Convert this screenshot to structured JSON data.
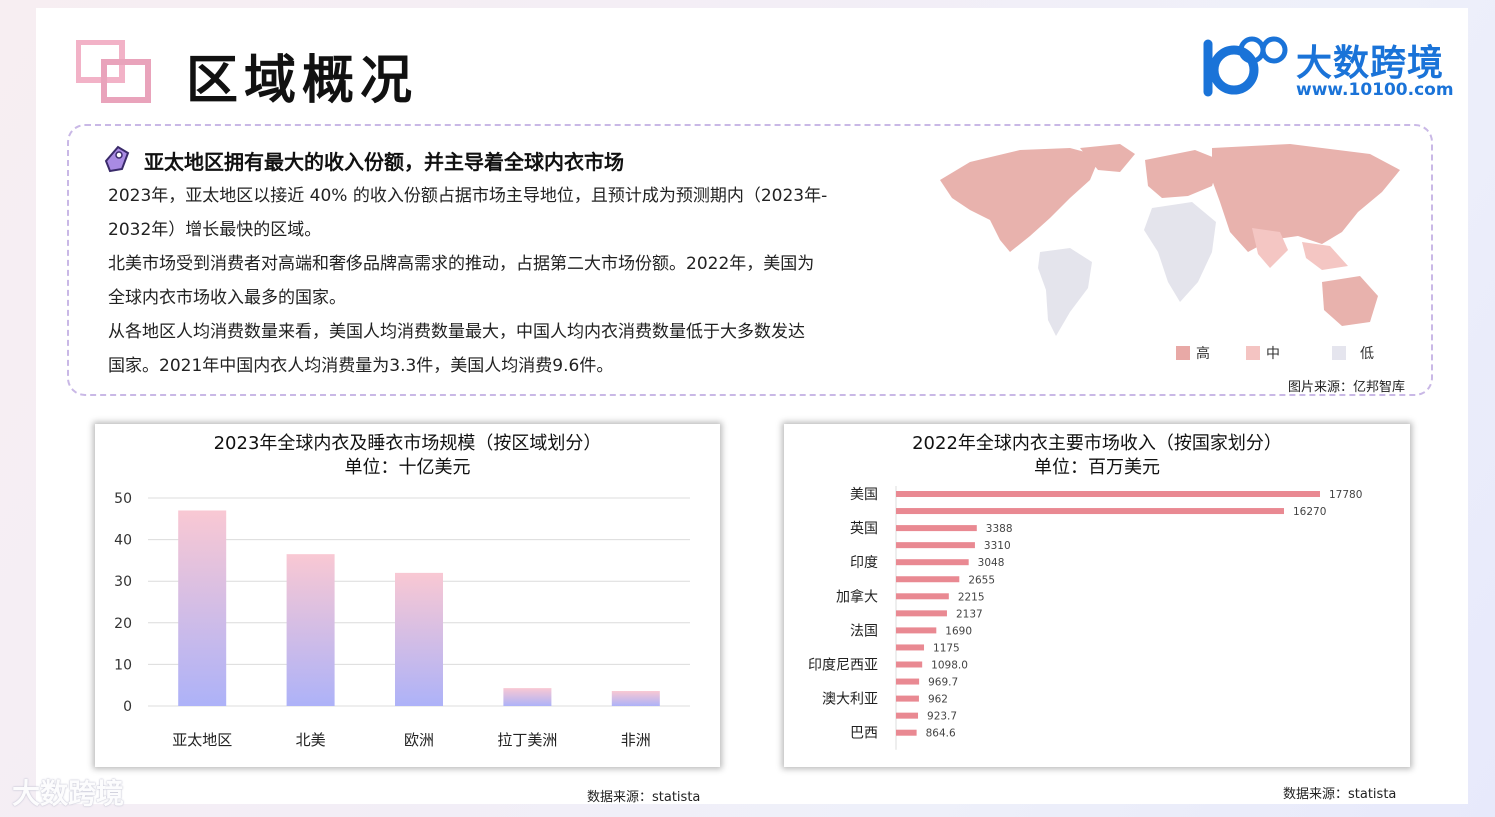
{
  "title": "区域概况",
  "brand": {
    "name": "大数跨境",
    "url": "www.10100.com",
    "logo_text": "100"
  },
  "summary": {
    "heading": "亚太地区拥有最大的收入份额，并主导着全球内衣市场",
    "lines": [
      "2023年，亚太地区以接近 40% 的收入份额占据市场主导地位，且预计成为预测期内（2023年-",
      "2032年）增长最快的区域。",
      "北美市场受到消费者对高端和奢侈品牌高需求的推动，占据第二大市场份额。2022年，美国为",
      "全球内衣市场收入最多的国家。",
      "从各地区人均消费数量来看，美国人均消费数量最大，中国人均内衣消费数量低于大多数发达",
      "国家。2021年中国内衣人均消费量为3.3件，美国人均消费9.6件。"
    ]
  },
  "map": {
    "legend": [
      {
        "label": "高",
        "color": "#e8a9a6"
      },
      {
        "label": "中",
        "color": "#f4c4c2"
      },
      {
        "label": "低",
        "color": "#e5e5ee"
      }
    ],
    "source": "图片来源：亿邦智库"
  },
  "chart_data": [
    {
      "type": "bar",
      "title": "2023年全球内衣及睡衣市场规模（按区域划分）",
      "subtitle": "单位：十亿美元",
      "categories": [
        "亚太地区",
        "北美",
        "欧洲",
        "拉丁美洲",
        "非洲"
      ],
      "values": [
        47,
        36.5,
        32,
        4.3,
        3.6
      ],
      "ylim": [
        0,
        50
      ],
      "yticks": [
        0,
        10,
        20,
        30,
        40,
        50
      ],
      "grid": true,
      "gradient": {
        "top": "#f9c8d3",
        "bottom": "#adb2f8"
      },
      "source": "数据来源：statista"
    },
    {
      "type": "bar",
      "orientation": "horizontal",
      "title": "2022年全球内衣主要市场收入（按国家划分）",
      "subtitle": "单位：百万美元",
      "labeled_categories": [
        "美国",
        "英国",
        "印度",
        "加拿大",
        "法国",
        "印度尼西亚",
        "澳大利亚",
        "巴西"
      ],
      "values": [
        17780,
        16270,
        3388,
        3310,
        3048,
        2655,
        2215,
        2137,
        1690,
        1175,
        1098.0,
        969.7,
        962,
        923.7,
        864.6
      ],
      "value_labels": [
        "17780",
        "16270",
        "3388",
        "3310",
        "3048",
        "2655",
        "2215",
        "2137",
        "1690",
        "1175",
        "1098.0",
        "969.7",
        "962",
        "923.7",
        "864.6"
      ],
      "bar_color": "#e98992",
      "source": "数据来源：statista"
    }
  ],
  "watermark": "大数跨境"
}
